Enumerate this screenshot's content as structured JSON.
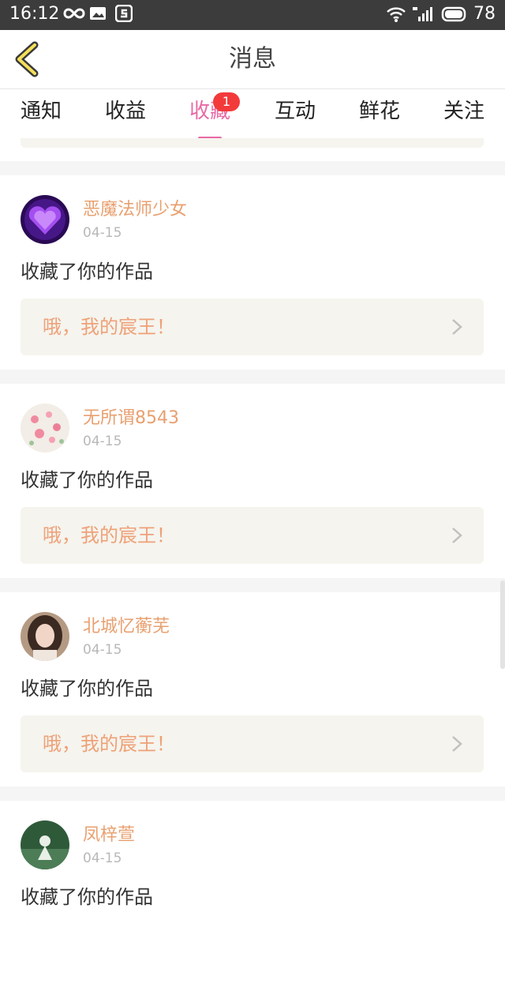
{
  "status_bar": {
    "time": "16:12",
    "battery": "78"
  },
  "header": {
    "title": "消息"
  },
  "tabs": [
    {
      "label": "通知"
    },
    {
      "label": "收益"
    },
    {
      "label": "收藏",
      "active": true,
      "badge": "1"
    },
    {
      "label": "互动"
    },
    {
      "label": "鲜花"
    },
    {
      "label": "关注"
    }
  ],
  "items": [
    {
      "name": "恶魔法师少女",
      "date": "04-15",
      "action": "收藏了你的作品",
      "work_title": "哦，我的宸王！"
    },
    {
      "name": "无所谓8543",
      "date": "04-15",
      "action": "收藏了你的作品",
      "work_title": "哦，我的宸王！"
    },
    {
      "name": "北城忆蘅芜",
      "date": "04-15",
      "action": "收藏了你的作品",
      "work_title": "哦，我的宸王！"
    },
    {
      "name": "凤梓萱",
      "date": "04-15",
      "action": "收藏了你的作品",
      "work_title": ""
    }
  ],
  "colors": {
    "accent": "#e86aa5",
    "name": "#e8a070",
    "badge": "#f33a3a",
    "card_bg": "#f5f4ee"
  }
}
